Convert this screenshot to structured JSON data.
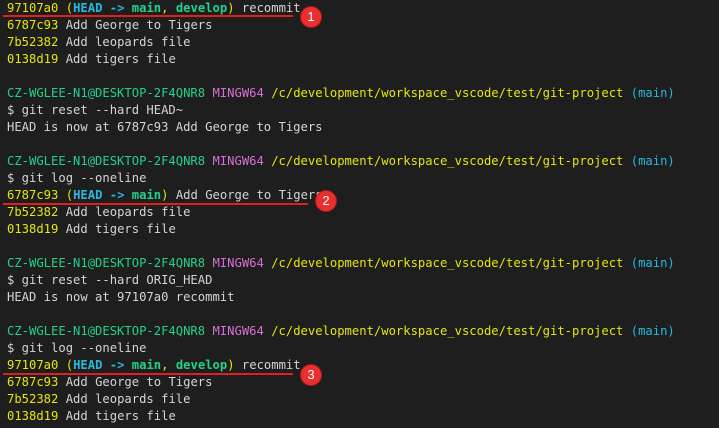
{
  "terminal": {
    "blocks": [
      {
        "log": [
          {
            "hash": "97107a0",
            "refs": {
              "head": "HEAD",
              "arrow": "->",
              "branches": [
                "main",
                "develop"
              ]
            },
            "message": "recommit"
          },
          {
            "hash": "6787c93",
            "message": "Add George to Tigers"
          },
          {
            "hash": "7b52382",
            "message": "Add leopards file"
          },
          {
            "hash": "0138d19",
            "message": "Add tigers file"
          }
        ]
      },
      {
        "prompt": {
          "user": "CZ-WGLEE-N1@DESKTOP-2F4QNR8",
          "shell": "MINGW64",
          "path": "/c/development/workspace_vscode/test/git-project",
          "branch": "(main)"
        },
        "command": "$ git reset --hard HEAD~",
        "output": "HEAD is now at 6787c93 Add George to Tigers"
      },
      {
        "prompt": {
          "user": "CZ-WGLEE-N1@DESKTOP-2F4QNR8",
          "shell": "MINGW64",
          "path": "/c/development/workspace_vscode/test/git-project",
          "branch": "(main)"
        },
        "command": "$ git log --oneline",
        "log": [
          {
            "hash": "6787c93",
            "refs": {
              "head": "HEAD",
              "arrow": "->",
              "branches": [
                "main"
              ]
            },
            "message": "Add George to Tigers"
          },
          {
            "hash": "7b52382",
            "message": "Add leopards file"
          },
          {
            "hash": "0138d19",
            "message": "Add tigers file"
          }
        ]
      },
      {
        "prompt": {
          "user": "CZ-WGLEE-N1@DESKTOP-2F4QNR8",
          "shell": "MINGW64",
          "path": "/c/development/workspace_vscode/test/git-project",
          "branch": "(main)"
        },
        "command": "$ git reset --hard ORIG_HEAD",
        "output": "HEAD is now at 97107a0 recommit"
      },
      {
        "prompt": {
          "user": "CZ-WGLEE-N1@DESKTOP-2F4QNR8",
          "shell": "MINGW64",
          "path": "/c/development/workspace_vscode/test/git-project",
          "branch": "(main)"
        },
        "command": "$ git log --oneline",
        "log": [
          {
            "hash": "97107a0",
            "refs": {
              "head": "HEAD",
              "arrow": "->",
              "branches": [
                "main",
                "develop"
              ]
            },
            "message": "recommit"
          },
          {
            "hash": "6787c93",
            "message": "Add George to Tigers"
          },
          {
            "hash": "7b52382",
            "message": "Add leopards file"
          },
          {
            "hash": "0138d19",
            "message": "Add tigers file"
          }
        ]
      }
    ]
  },
  "annotations": {
    "markers": [
      "1",
      "2",
      "3"
    ]
  },
  "colors": {
    "background": "#1e1e1e",
    "text": "#d4d4d4",
    "hash": "#e5e510",
    "head_ref": "#29b8db",
    "branch_ref": "#23d18b",
    "user_host": "#23d18b",
    "shell": "#d670d6",
    "path": "#e5e510",
    "annotation": "#e02020"
  }
}
